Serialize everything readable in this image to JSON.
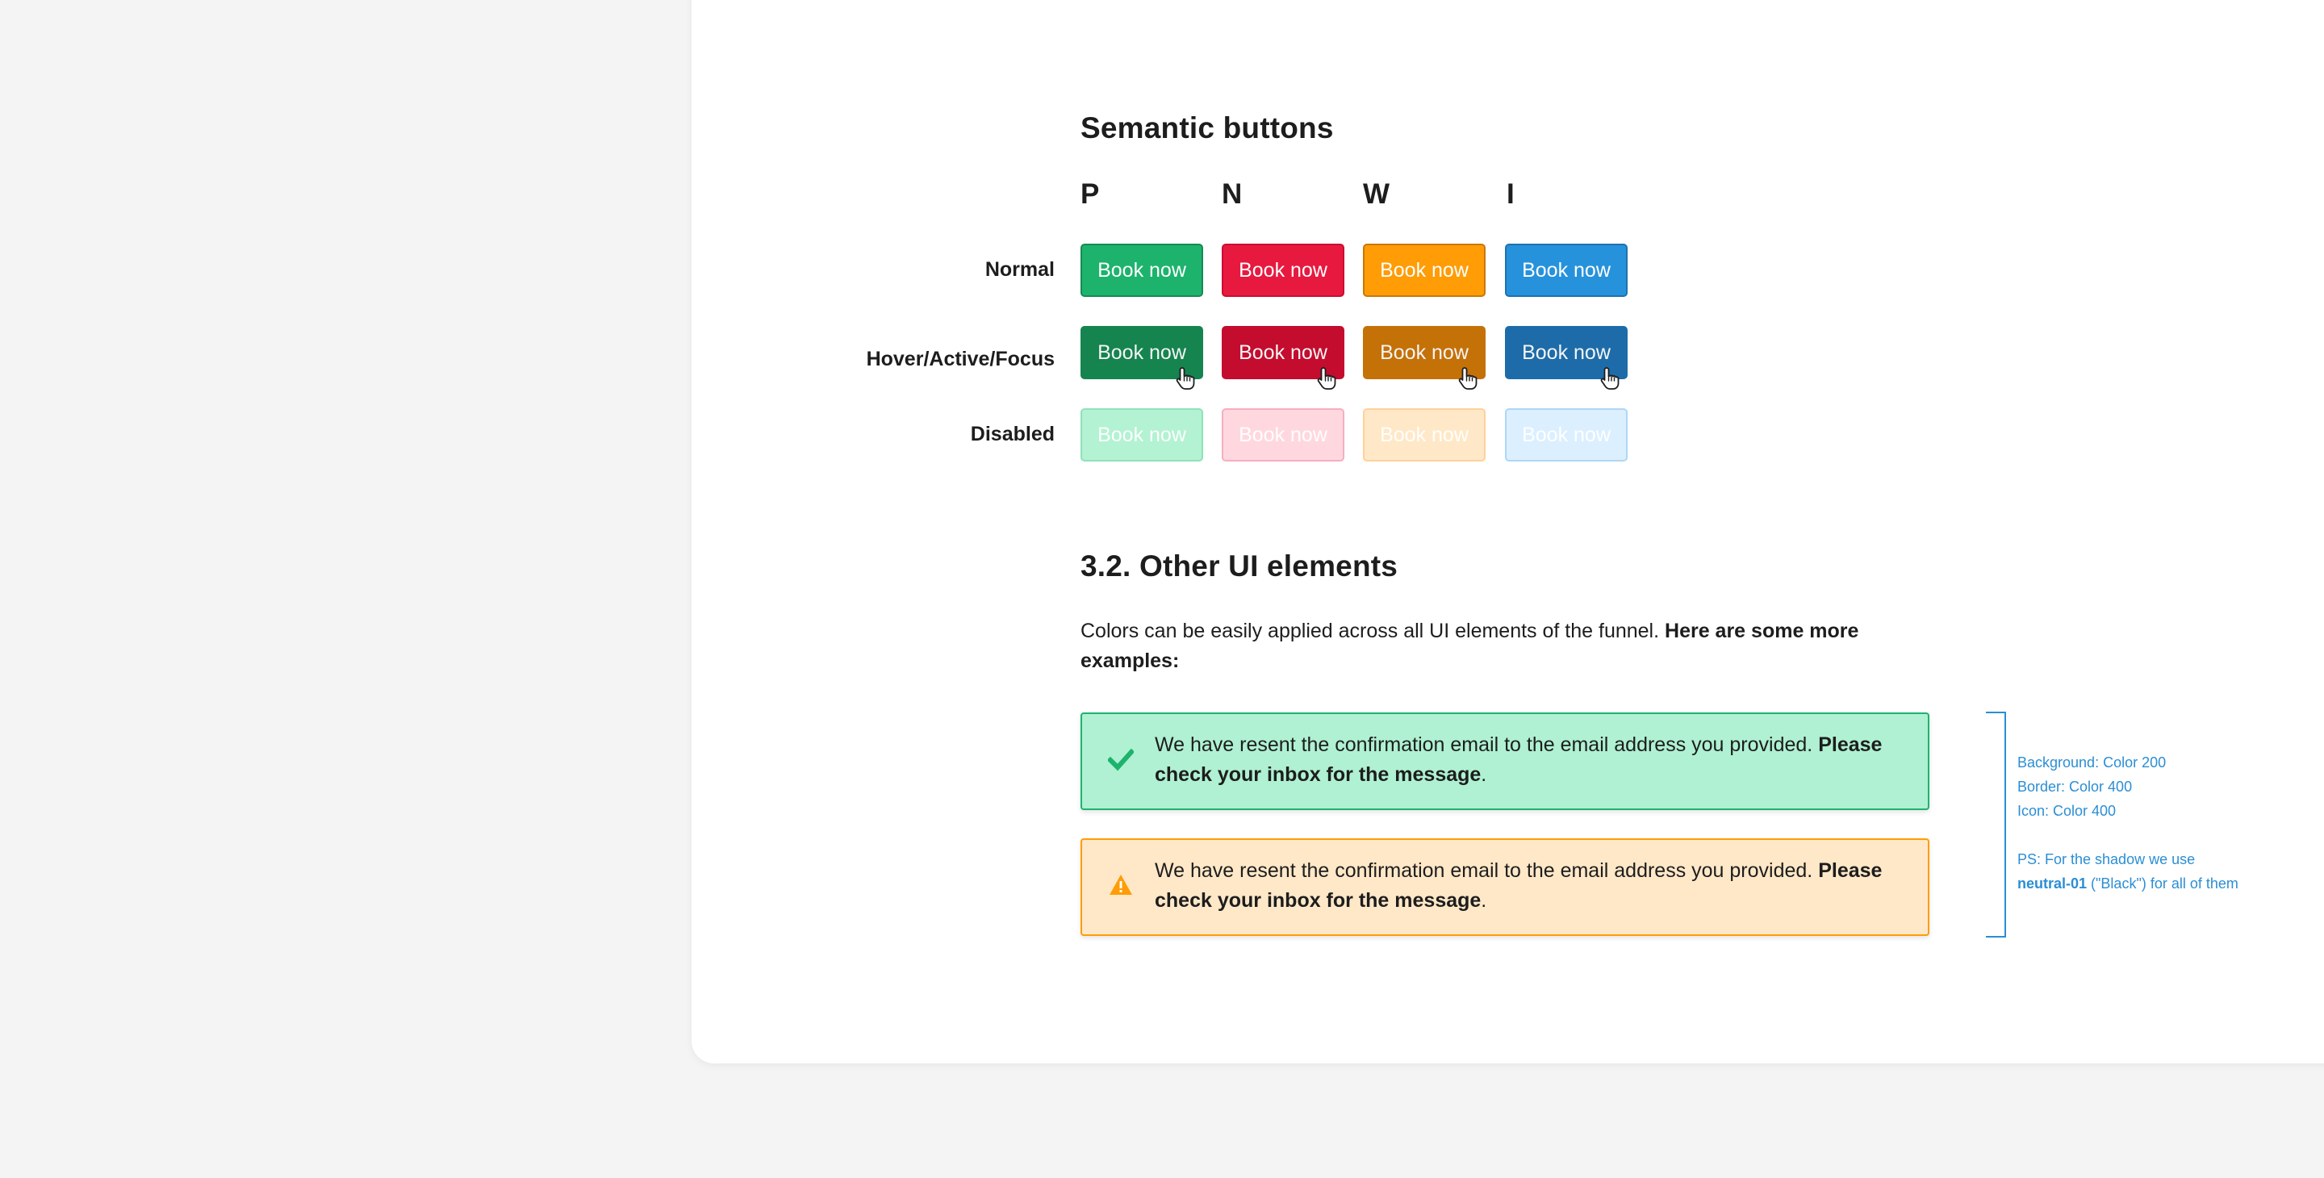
{
  "sections": {
    "semantic_buttons": {
      "title": "Semantic buttons",
      "columns": [
        "P",
        "N",
        "W",
        "I"
      ],
      "rows": [
        "Normal",
        "Hover/Active/Focus",
        "Disabled"
      ],
      "button_label": "Book now",
      "colors": {
        "normal": [
          "#1db36d",
          "#e8193f",
          "#ff9c06",
          "#2792dc"
        ],
        "hover": [
          "#168a52",
          "#cc0d30",
          "#cc7608",
          "#1e71b0"
        ],
        "disabled_bg": [
          "#b3f2d2",
          "#ffd8df",
          "#ffe8c8",
          "#dcefff"
        ],
        "disabled_border": [
          "#8fe3b9",
          "#f7aebf",
          "#ffd19a",
          "#aed7f5"
        ]
      }
    },
    "other_ui": {
      "title": "3.2. Other UI elements",
      "intro": "Colors can be easily applied across all UI elements of the funnel.",
      "intro_bold": "Here are some more examples:",
      "alerts": [
        {
          "icon": "checkmark-icon",
          "text": "We have resent the confirmation email to the email address you provided.",
          "text_bold": "Please check your inbox for the message",
          "text_end": ".",
          "bg": "#aff1d2",
          "border": "#1db36d",
          "icon_color": "#1db36d"
        },
        {
          "icon": "warning-icon",
          "text": "We have resent the confirmation email to the email address you provided.",
          "text_bold": "Please check your inbox for the message",
          "text_end": ".",
          "bg": "#ffe8c8",
          "border": "#ff9c06",
          "icon_color": "#ff9c06"
        }
      ]
    }
  },
  "annotation": {
    "line1": "Background: Color 200",
    "line2": "Border: Color 400",
    "line3": "Icon: Color 400",
    "ps": "PS: For the shadow we use",
    "ps_bold": "neutral-01",
    "ps_end": "(\"Black\") for all of them",
    "color": "#2b8ed4"
  }
}
